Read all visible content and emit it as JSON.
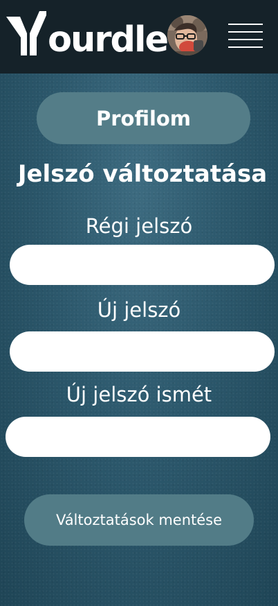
{
  "header": {
    "logo_text": "ourdle",
    "logo_icon": "y-mark-logo",
    "avatar_icon": "user-avatar",
    "menu_icon": "hamburger-menu-icon"
  },
  "profile_button": {
    "label": "Profilom"
  },
  "page_title": "Jelszó változtatása",
  "form": {
    "old_password_label": "Régi jelszó",
    "old_password_value": "",
    "new_password_label": "Új jelszó",
    "new_password_value": "",
    "confirm_password_label": "Új jelszó ismét",
    "confirm_password_value": ""
  },
  "save_button": {
    "label": "Változtatások mentése"
  },
  "colors": {
    "header_bg": "#152229",
    "page_bg": "#2c586c",
    "pill_bg": "#547d88",
    "text": "#ffffff",
    "input_bg": "#ffffff"
  }
}
